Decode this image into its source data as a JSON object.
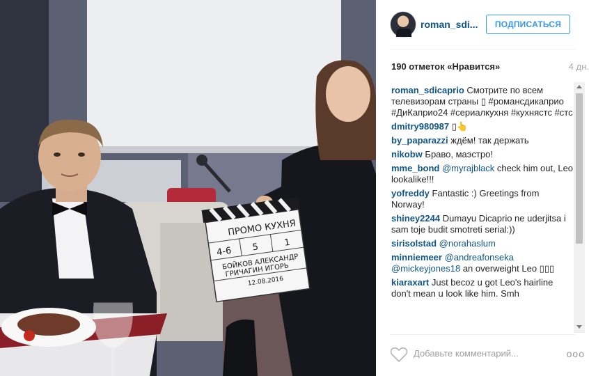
{
  "header": {
    "username": "roman_sdi...",
    "follow_label": "ПОДПИСАТЬСЯ"
  },
  "meta": {
    "likes": "190 отметок «Нравится»",
    "time": "4 дн."
  },
  "comments": [
    {
      "user": "roman_sdicaprio",
      "mention": "",
      "text": "Смотрите по всем телевизорам страны ▯ #романсдикаприо #ДиКаприо24 #сериалкухня #кухнястс #стс"
    },
    {
      "user": "dmitry980987",
      "mention": "",
      "text": "▯👆"
    },
    {
      "user": "by_paparazzi",
      "mention": "",
      "text": "ждём! так держать"
    },
    {
      "user": "nikobw",
      "mention": "",
      "text": "Браво, маэстро!"
    },
    {
      "user": "mme_bond",
      "mention": "@myrajblack",
      "text": "check him out, Leo lookalike!!!"
    },
    {
      "user": "yofreddy",
      "mention": "",
      "text": "Fantastic :) Greetings from Norway!"
    },
    {
      "user": "shiney2244",
      "mention": "",
      "text": "Dumayu Dicaprio ne uderjitsa i sam toje budit smotreti serial:))"
    },
    {
      "user": "sirisolstad",
      "mention": "@norahaslum",
      "text": ""
    },
    {
      "user": "minniemeer",
      "mention": "@andreafonseka @mickeyjones18",
      "text": "an overweight Leo ▯▯▯"
    },
    {
      "user": "kiaraxart",
      "mention": "",
      "text": "Just becoz u got Leo's hairline don't mean u look like him. Smh"
    }
  ],
  "footer": {
    "comment_placeholder": "Добавьте комментарий...",
    "more_label": "ooo"
  },
  "clapperboard": {
    "title": "ПРОМО КУХНЯ",
    "scene": "4-6",
    "take": "5",
    "roll": "1",
    "names": "БОЙКОВ АЛЕКСАНДР",
    "names2": "ГРИЧАГИН ИГОРЬ",
    "date": "12.08.2016"
  },
  "icons": {
    "heart": "heart-icon",
    "more": "more-icon",
    "avatar": "avatar"
  },
  "colors": {
    "accent": "#3897f0",
    "username": "#125688"
  }
}
